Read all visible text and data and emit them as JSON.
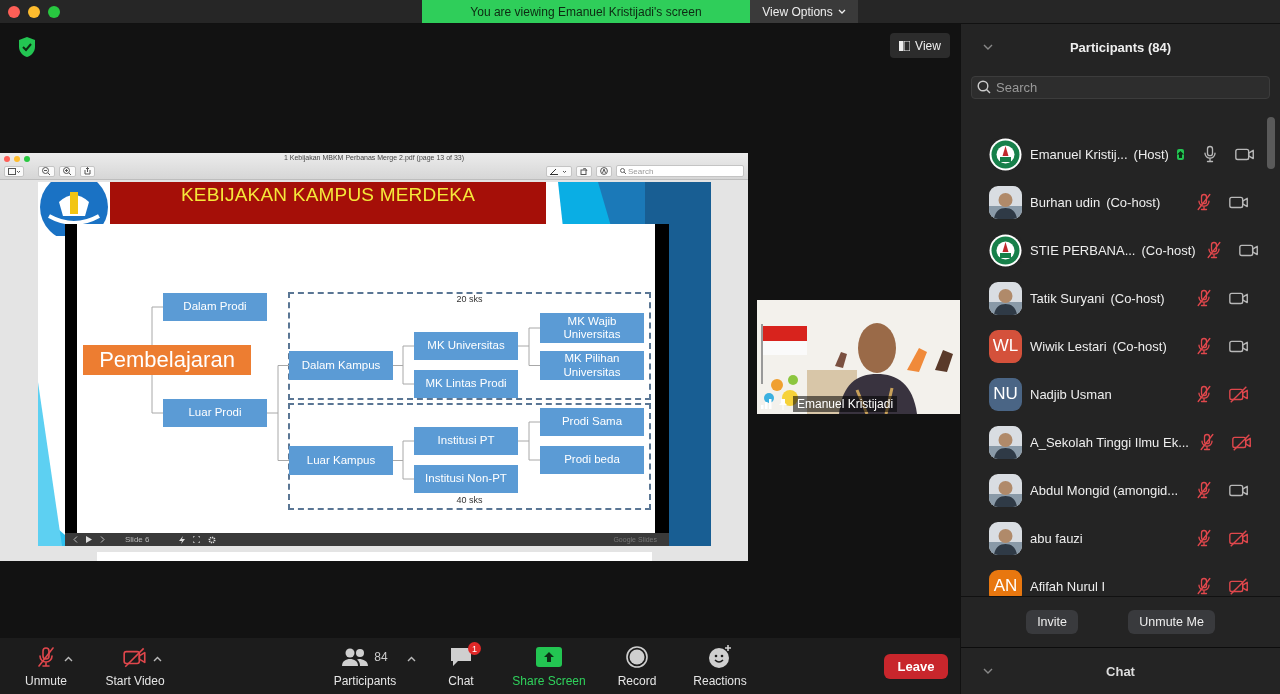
{
  "banner": {
    "text": "You are viewing Emanuel Kristijadi's screen",
    "view_options": "View Options"
  },
  "view_button": "View",
  "shared_window": {
    "title": "1 Kebijakan MBKM Perbanas Merge 2.pdf (page 13 of 33)",
    "search_placeholder": "Search",
    "slide": {
      "title": "KEBIJAKAN KAMPUS MERDEKA",
      "diagram": {
        "label": "Pembelajaran",
        "children": [
          {
            "label": "Dalam Prodi"
          },
          {
            "label": "Luar Prodi",
            "children": [
              {
                "label": "Dalam Kampus",
                "children": [
                  {
                    "label": "MK Universitas",
                    "children": [
                      {
                        "label": "MK Wajib Universitas"
                      },
                      {
                        "label": "MK Pilihan Universitas"
                      }
                    ]
                  },
                  {
                    "label": "MK Lintas Prodi"
                  }
                ]
              },
              {
                "label": "Luar Kampus",
                "children": [
                  {
                    "label": "Institusi PT",
                    "children": [
                      {
                        "label": "Prodi Sama"
                      },
                      {
                        "label": "Prodi beda"
                      }
                    ]
                  },
                  {
                    "label": "Institusi Non-PT"
                  }
                ]
              }
            ]
          }
        ]
      },
      "groups": [
        {
          "label": "20 sks"
        },
        {
          "label": "40 sks"
        }
      ],
      "player": {
        "slide_label": "Slide 6",
        "brand": "Google Slides"
      }
    }
  },
  "video_tile": {
    "name": "Emanuel Kristijadi"
  },
  "toolbar": {
    "items": [
      {
        "kind": "mic",
        "label": "Unmute",
        "muted": true,
        "menu": true
      },
      {
        "kind": "video",
        "label": "Start Video",
        "video_off": true,
        "menu": true
      },
      {
        "kind": "participants",
        "label": "Participants",
        "count": "84",
        "menu": true
      },
      {
        "kind": "chat",
        "label": "Chat",
        "badge": "1"
      },
      {
        "kind": "share",
        "label": "Share Screen"
      },
      {
        "kind": "record",
        "label": "Record"
      },
      {
        "kind": "reactions",
        "label": "Reactions"
      }
    ],
    "leave": "Leave"
  },
  "participants_panel": {
    "title": "Participants (84)",
    "search": {
      "placeholder": "Search"
    },
    "participants": [
      {
        "name": "Emanuel Kristij...",
        "role": "(Host)",
        "avatar": {
          "kind": "logo"
        },
        "sharing": true,
        "muted": false,
        "video_off": false
      },
      {
        "name": "Burhan udin",
        "role": "(Co-host)",
        "sharing": false,
        "muted": true,
        "video_off": false
      },
      {
        "name": "STIE PERBANA...",
        "role": "(Co-host)",
        "avatar": {
          "kind": "logo"
        },
        "sharing": false,
        "muted": true,
        "video_off": false
      },
      {
        "name": "Tatik Suryani",
        "role": "(Co-host)",
        "sharing": false,
        "muted": true,
        "video_off": false
      },
      {
        "name": "Wiwik Lestari",
        "role": "(Co-host)",
        "avatar": {
          "kind": "initials",
          "text": "WL",
          "color": "#d4513b"
        },
        "sharing": false,
        "muted": true,
        "video_off": false
      },
      {
        "name": "Nadjib Usman",
        "avatar": {
          "kind": "initials",
          "text": "NU",
          "color": "#4a6585"
        },
        "sharing": false,
        "muted": true,
        "video_off": true
      },
      {
        "name": "A_Sekolah Tinggi Ilmu Ek...",
        "sharing": false,
        "muted": true,
        "video_off": true
      },
      {
        "name": "Abdul Mongid  (amongid...",
        "sharing": false,
        "muted": true,
        "video_off": false
      },
      {
        "name": "abu fauzi",
        "sharing": false,
        "muted": true,
        "video_off": true
      },
      {
        "name": "Afifah Nurul I",
        "avatar": {
          "kind": "initials",
          "text": "AN",
          "color": "#e8770f"
        },
        "sharing": false,
        "muted": true,
        "video_off": true
      }
    ],
    "buttons": [
      "Invite",
      "Unmute Me"
    ]
  },
  "chat_panel": {
    "title": "Chat"
  }
}
